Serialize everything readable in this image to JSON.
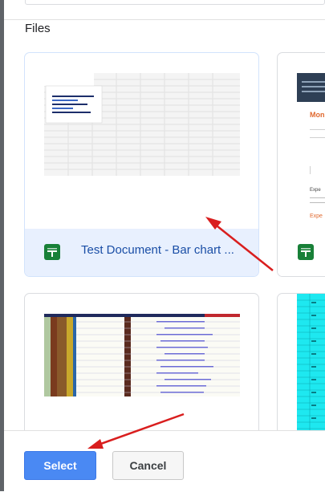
{
  "section_title": "Files",
  "files": [
    {
      "title": "Test Document - Bar chart ...",
      "type": "sheets-icon",
      "selected": true
    },
    {
      "title": "",
      "type": "sheets-icon",
      "selected": false
    },
    {
      "title": "",
      "type": "spreadsheet",
      "selected": false
    },
    {
      "title": "",
      "type": "spreadsheet",
      "selected": false
    }
  ],
  "preview_texts": {
    "heading": "Mon",
    "label": "Expe",
    "label2": "Expe"
  },
  "buttons": {
    "select": "Select",
    "cancel": "Cancel"
  },
  "colors": {
    "accent": "#4a89f3",
    "sheets_green": "#188038",
    "selected_bg": "#e8f0fe",
    "annotation_red": "#d91e1e"
  }
}
